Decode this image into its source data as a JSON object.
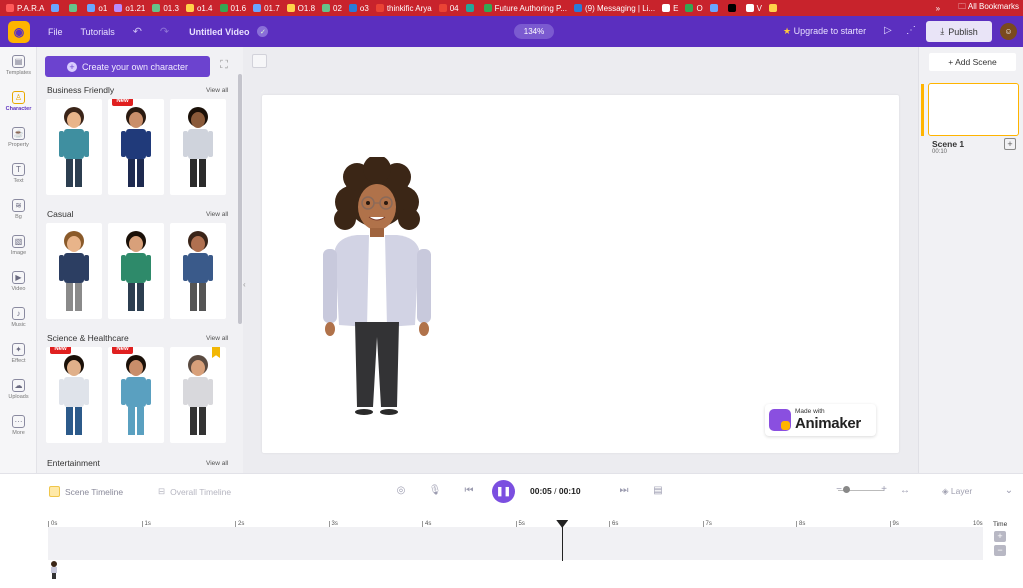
{
  "bookmarks": [
    {
      "label": "P.A.R.A",
      "color": "#ff5a5a"
    },
    {
      "label": "",
      "color": "#6aa6ff"
    },
    {
      "label": "",
      "color": "#66c28a"
    },
    {
      "label": "o1",
      "color": "#6aa6ff"
    },
    {
      "label": "o1.21",
      "color": "#b88cff"
    },
    {
      "label": "01.3",
      "color": "#66c28a"
    },
    {
      "label": "o1.4",
      "color": "#ffd24a"
    },
    {
      "label": "01.6",
      "color": "#34a853"
    },
    {
      "label": "01.7",
      "color": "#6aa6ff"
    },
    {
      "label": "O1.8",
      "color": "#ffd24a"
    },
    {
      "label": "02",
      "color": "#66c28a"
    },
    {
      "label": "o3",
      "color": "#2a7bd6"
    },
    {
      "label": "thinkific Arya",
      "color": "#ea4335"
    },
    {
      "label": "04",
      "color": "#ea4335"
    },
    {
      "label": "",
      "color": "#26a69a"
    },
    {
      "label": "Future Authoring P...",
      "color": "#34a853"
    },
    {
      "label": "(9) Messaging | Li...",
      "color": "#2a7bd6"
    },
    {
      "label": "E",
      "color": "#ffffff"
    },
    {
      "label": "O",
      "color": "#34a853"
    },
    {
      "label": "",
      "color": "#6aa6ff"
    },
    {
      "label": "",
      "color": "#000000"
    },
    {
      "label": "V",
      "color": "#ffffff"
    },
    {
      "label": "",
      "color": "#ffd24a"
    }
  ],
  "bookmarks_right": {
    "overflow": "»",
    "all": "All Bookmarks"
  },
  "toolbar": {
    "file": "File",
    "tutorials": "Tutorials",
    "undo": "↶",
    "redo": "↷",
    "title": "Untitled Video",
    "zoom": "134%",
    "upgrade": "Upgrade to starter",
    "publish": "Publish"
  },
  "rail": [
    {
      "label": "Templates",
      "icon": "▤"
    },
    {
      "label": "Character",
      "icon": "♙",
      "active": true
    },
    {
      "label": "Property",
      "icon": "☕"
    },
    {
      "label": "Text",
      "icon": "T"
    },
    {
      "label": "Bg",
      "icon": "≋"
    },
    {
      "label": "Image",
      "icon": "▧"
    },
    {
      "label": "Video",
      "icon": "▶"
    },
    {
      "label": "Music",
      "icon": "♪"
    },
    {
      "label": "Effect",
      "icon": "✦"
    },
    {
      "label": "Uploads",
      "icon": "☁"
    },
    {
      "label": "More",
      "icon": "···"
    }
  ],
  "panel": {
    "create": "Create your own character",
    "view_all": "View all",
    "sections": [
      {
        "title": "Business Friendly",
        "cards": [
          {
            "badge": "",
            "skin": "#e8b48a",
            "hair": "#3a2418",
            "top": "#3f8fa0",
            "legs": "#2c3e50"
          },
          {
            "badge": "New",
            "skin": "#c98e6a",
            "hair": "#2a1a10",
            "top": "#203a7a",
            "legs": "#1e2a50"
          },
          {
            "badge": "",
            "skin": "#8a5a3a",
            "hair": "#1a1008",
            "top": "#cfd3dc",
            "legs": "#2b2b2b"
          }
        ]
      },
      {
        "title": "Casual",
        "cards": [
          {
            "badge": "",
            "skin": "#e8b48a",
            "hair": "#8a5a2a",
            "top": "#2c3e62",
            "legs": "#8a8a8a"
          },
          {
            "badge": "",
            "skin": "#d8a07a",
            "hair": "#1a1008",
            "top": "#2e8a6a",
            "legs": "#2c3e50"
          },
          {
            "badge": "",
            "skin": "#b07050",
            "hair": "#3a2418",
            "top": "#3a5a8a",
            "legs": "#555555"
          }
        ]
      },
      {
        "title": "Science & Healthcare",
        "cards": [
          {
            "badge": "New",
            "skin": "#e0b08a",
            "hair": "#1a1008",
            "top": "#dfe3ea",
            "legs": "#2c5a8a"
          },
          {
            "badge": "New",
            "skin": "#c98e6a",
            "hair": "#1a1008",
            "top": "#5aa0c0",
            "legs": "#5aa0c0"
          },
          {
            "badge": "fav",
            "skin": "#d8a07a",
            "hair": "#5a4a40",
            "top": "#d8d8dc",
            "legs": "#333333"
          }
        ]
      },
      {
        "title": "Entertainment",
        "cards": []
      }
    ]
  },
  "watermark": {
    "small": "Made with",
    "brand": "Animaker"
  },
  "scenes": {
    "add": "+ Add Scene",
    "items": [
      {
        "name": "Scene 1",
        "duration": "00:10"
      }
    ]
  },
  "timeline": {
    "scene_tab": "Scene Timeline",
    "overall_tab": "Overall Timeline",
    "current": "00:05",
    "separator": " / ",
    "total": "00:10",
    "layer": "Layer",
    "time_label": "Time",
    "ticks": [
      "0s",
      "1s",
      "2s",
      "3s",
      "4s",
      "5s",
      "6s",
      "7s",
      "8s",
      "9s",
      "10s"
    ],
    "playhead_seconds": 5.5,
    "duration_seconds": 10
  },
  "colors": {
    "brand": "#5b2fbf",
    "accent": "#ffb400",
    "bookmark_bar": "#c8232c"
  }
}
